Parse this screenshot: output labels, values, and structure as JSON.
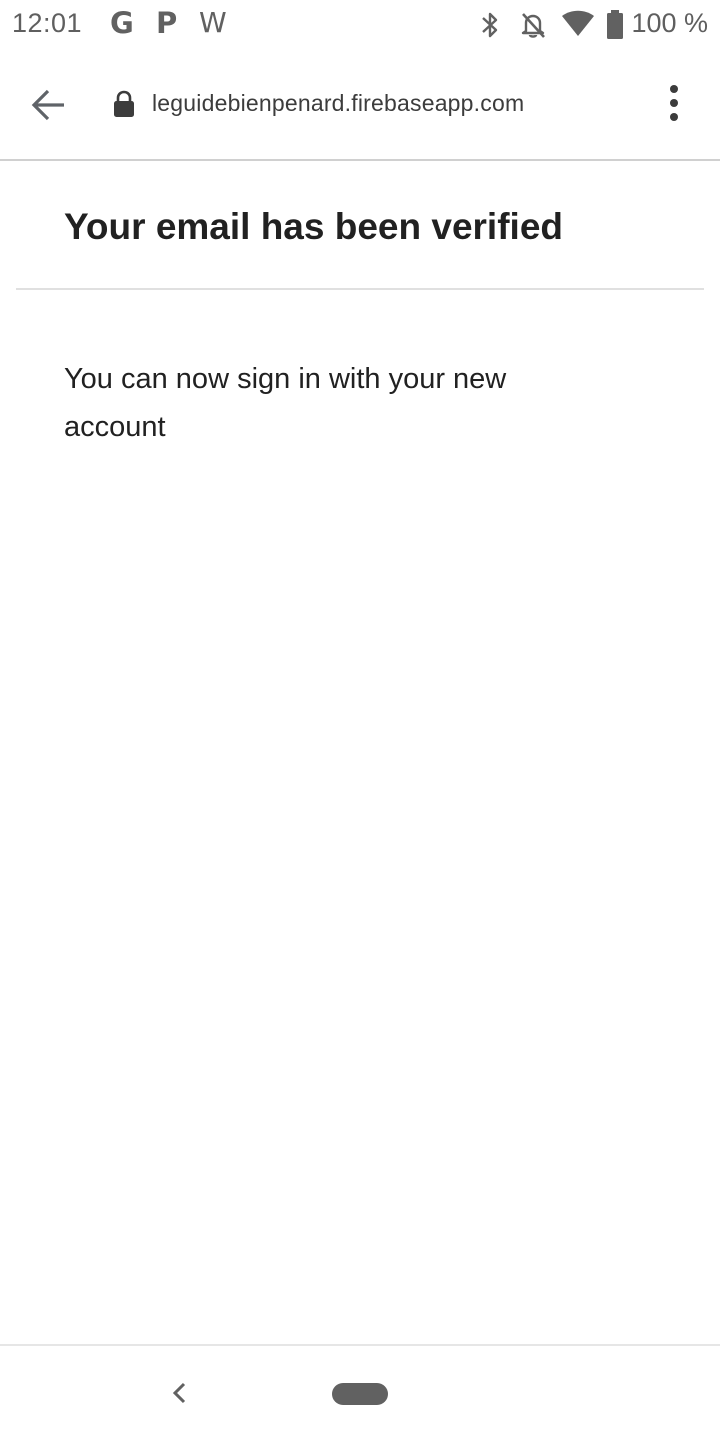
{
  "status_bar": {
    "time": "12:01",
    "notifications": [
      "G",
      "P",
      "W"
    ],
    "battery": "100 %",
    "icons": [
      "bluetooth-icon",
      "notifications-off-icon",
      "wifi-icon",
      "battery-icon"
    ]
  },
  "browser": {
    "url": "leguidebienpenard.firebaseapp.com",
    "icons": [
      "back-arrow-icon",
      "lock-icon",
      "more-vert-icon"
    ]
  },
  "page": {
    "heading": "Your email has been verified",
    "message": "You can now sign in with your new account"
  },
  "nav_bar": {
    "icons": [
      "nav-back-icon",
      "nav-home-pill"
    ]
  },
  "colors": {
    "text": "#212121",
    "icon": "#616161",
    "divider": "#e0e0e0",
    "background": "#ffffff"
  }
}
